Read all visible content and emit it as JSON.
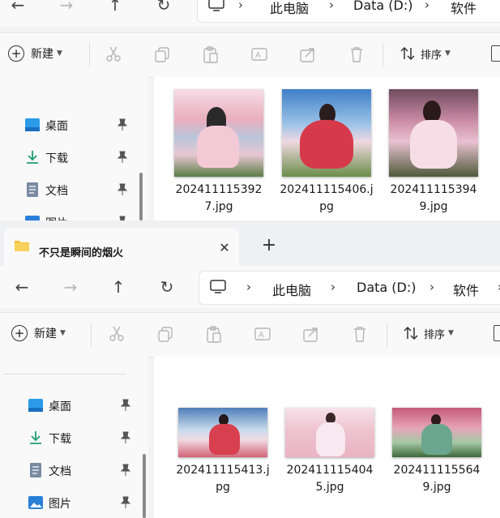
{
  "back_window": {
    "address": {
      "pc": "此电脑",
      "drive": "Data (D:)",
      "folder": "软件"
    },
    "commands": {
      "new_label": "新建",
      "sort_label": "排序"
    },
    "sidebar": [
      {
        "label": "桌面",
        "icon": "desktop-icon"
      },
      {
        "label": "下载",
        "icon": "download-icon"
      },
      {
        "label": "文档",
        "icon": "document-icon"
      },
      {
        "label": "图片",
        "icon": "pictures-icon"
      }
    ],
    "files": [
      {
        "name": "2024111153927.jpg",
        "line1": "202411115392",
        "line2": "7.jpg"
      },
      {
        "name": "202411115406.jpg",
        "line1": "202411115406.j",
        "line2": "pg"
      },
      {
        "name": "2024111153949.jpg",
        "line1": "202411115394",
        "line2": "9.jpg"
      }
    ]
  },
  "front_window": {
    "tab_title": "不只是瞬间的烟火",
    "address": {
      "pc": "此电脑",
      "drive": "Data (D:)",
      "folder": "软件"
    },
    "commands": {
      "new_label": "新建",
      "sort_label": "排序"
    },
    "sidebar": [
      {
        "label": "桌面",
        "icon": "desktop-icon"
      },
      {
        "label": "下载",
        "icon": "download-icon"
      },
      {
        "label": "文档",
        "icon": "document-icon"
      },
      {
        "label": "图片",
        "icon": "pictures-icon"
      }
    ],
    "files": [
      {
        "name": "202411115413.jpg",
        "line1": "202411115413.j",
        "line2": "pg"
      },
      {
        "name": "2024111154045.jpg",
        "line1": "202411115404",
        "line2": "5.jpg"
      },
      {
        "name": "2024111155649.jpg",
        "line1": "202411115564",
        "line2": "9.jpg"
      }
    ]
  },
  "colors": {
    "accent": "#0067c0",
    "folder": "#f4c43a",
    "pin": "#555555"
  }
}
